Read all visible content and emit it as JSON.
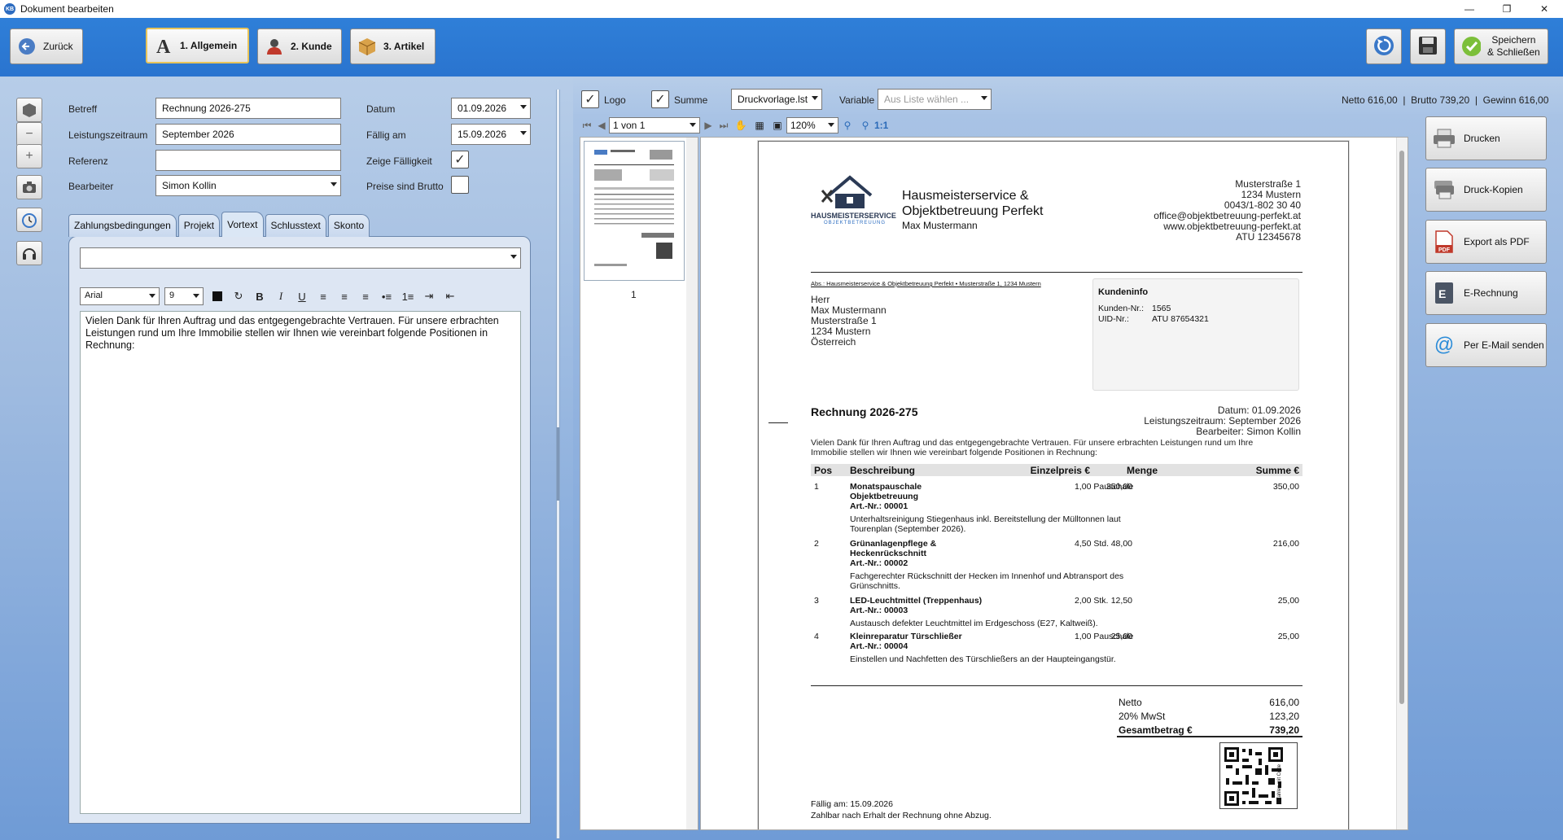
{
  "window": {
    "title": "Dokument bearbeiten",
    "app_badge": "KB"
  },
  "toolbar": {
    "back_label": "Zurück",
    "tabs": [
      {
        "label": "1. Allgemein",
        "icon": "letter-a-icon"
      },
      {
        "label": "2. Kunde",
        "icon": "person-icon"
      },
      {
        "label": "3. Artikel",
        "icon": "box-icon"
      }
    ],
    "save_close_label": "Speichern\n& Schließen"
  },
  "form": {
    "betreff_label": "Betreff",
    "betreff_value": "Rechnung 2026-275",
    "zeitraum_label": "Leistungszeitraum",
    "zeitraum_value": "September 2026",
    "referenz_label": "Referenz",
    "referenz_value": "",
    "bearbeiter_label": "Bearbeiter",
    "bearbeiter_value": "Simon Kollin",
    "datum_label": "Datum",
    "datum_value": "01.09.2026",
    "faellig_label": "Fällig am",
    "faellig_value": "15.09.2026",
    "zeige_label": "Zeige Fälligkeit",
    "zeige_checked": true,
    "brutto_label": "Preise sind Brutto",
    "brutto_checked": false
  },
  "tabs": [
    "Zahlungsbedingungen",
    "Projekt",
    "Vortext",
    "Schlusstext",
    "Skonto"
  ],
  "active_tab": "Vortext",
  "editor": {
    "font": "Arial",
    "size": "9",
    "text": "Vielen Dank für Ihren Auftrag und das entgegengebrachte Vertrauen. Für unsere erbrachten Leistungen rund um Ihre Immobilie stellen wir Ihnen wie vereinbart folgende Positionen in Rechnung:"
  },
  "preview_options": {
    "logo_label": "Logo",
    "logo_checked": true,
    "summe_label": "Summe",
    "summe_checked": true,
    "template": "Druckvorlage.lst",
    "variable_label": "Variable",
    "variable_placeholder": "Aus Liste wählen ...",
    "totals": "Netto 616,00  |  Brutto 739,20  |  Gewinn 616,00"
  },
  "nav": {
    "page": "1 von 1",
    "zoom": "120%",
    "onetoone": "1:1",
    "thumb_page": "1"
  },
  "actions": [
    "Drucken",
    "Druck-Kopien",
    "Export als PDF",
    "E-Rechnung",
    "Per E-Mail senden"
  ],
  "invoice": {
    "company_line1": "Hausmeisterservice &",
    "company_line2": "Objektbetreuung Perfekt",
    "owner": "Max Mustermann",
    "logo_text": "HAUSMEISTERSERVICE",
    "logo_sub": "OBJEKTBETREUUNG",
    "address": [
      "Musterstraße 1",
      "1234 Mustern",
      "0043/1-802 30 40",
      "office@objektbetreuung-perfekt.at",
      "www.objektbetreuung-perfekt.at",
      "ATU 12345678"
    ],
    "sender_line": "Abs.: Hausmeisterservice & Objektbetreuung Perfekt • Musterstraße 1, 1234 Mustern",
    "recipient": [
      "Herr",
      "Max Mustermann",
      "Musterstraße 1",
      "1234 Mustern",
      "Österreich"
    ],
    "kundeninfo_title": "Kundeninfo",
    "kunden_nr_label": "Kunden-Nr.:",
    "kunden_nr": "1565",
    "uid_label": "UID-Nr.:",
    "uid": "ATU 87654321",
    "title": "Rechnung 2026-275",
    "datum": "Datum: 01.09.2026",
    "zeitraum": "Leistungszeitraum: September 2026",
    "bearbeiter": "Bearbeiter: Simon Kollin",
    "intro": [
      "Vielen Dank für Ihren Auftrag und das entgegengebrachte Vertrauen. Für unsere erbrachten Leistungen rund um Ihre",
      "Immobilie stellen wir Ihnen wie vereinbart folgende Positionen in Rechnung:"
    ],
    "headers": [
      "Pos",
      "Beschreibung",
      "Einzelpreis €",
      "Menge",
      "Summe €"
    ],
    "items": [
      {
        "pos": "1",
        "name": [
          "Monatspauschale",
          "Objektbetreuung"
        ],
        "art": "Art.-Nr.: 00001",
        "price": "350,00",
        "qty": "1,00 Pauschale",
        "sum": "350,00",
        "desc": [
          "Unterhaltsreinigung Stiegenhaus inkl. Bereitstellung der Mülltonnen laut",
          "Tourenplan (September 2026)."
        ]
      },
      {
        "pos": "2",
        "name": [
          "Grünanlagenpflege &",
          "Heckenrückschnitt"
        ],
        "art": "Art.-Nr.: 00002",
        "price": "48,00",
        "qty": "4,50 Std.",
        "sum": "216,00",
        "desc": [
          "Fachgerechter Rückschnitt der Hecken im Innenhof und Abtransport des",
          "Grünschnitts."
        ]
      },
      {
        "pos": "3",
        "name": [
          "LED-Leuchtmittel (Treppenhaus)"
        ],
        "art": "Art.-Nr.: 00003",
        "price": "12,50",
        "qty": "2,00 Stk.",
        "sum": "25,00",
        "desc": [
          "Austausch defekter Leuchtmittel im Erdgeschoss (E27, Kaltweiß)."
        ]
      },
      {
        "pos": "4",
        "name": [
          "Kleinreparatur Türschließer"
        ],
        "art": "Art.-Nr.: 00004",
        "price": "25,00",
        "qty": "1,00 Pauschale",
        "sum": "25,00",
        "desc": [
          "Einstellen und Nachfetten des Türschließers an der Haupteingangstür."
        ]
      }
    ],
    "netto_label": "Netto",
    "netto": "616,00",
    "mwst_label": "20% MwSt",
    "mwst": "123,20",
    "gesamt_label": "Gesamtbetrag €",
    "gesamt": "739,20",
    "qr_caption": "Zahlen mit Code",
    "faellig": "Fällig am: 15.09.2026",
    "zahlbar": "Zahlbar nach Erhalt der Rechnung ohne Abzug."
  }
}
